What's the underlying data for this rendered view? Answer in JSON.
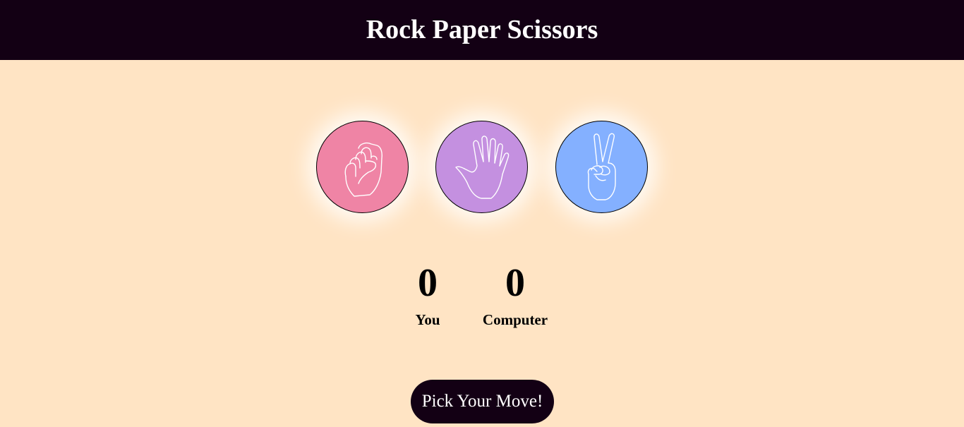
{
  "header": {
    "title": "Rock Paper Scissors"
  },
  "choices": [
    {
      "id": "rock",
      "icon": "rock-fist-icon",
      "color": "#ef84a5"
    },
    {
      "id": "paper",
      "icon": "paper-hand-icon",
      "color": "#c490e0"
    },
    {
      "id": "scissors",
      "icon": "scissors-hand-icon",
      "color": "#84b0ff"
    }
  ],
  "scoreboard": {
    "user": {
      "score": "0",
      "label": "You"
    },
    "computer": {
      "score": "0",
      "label": "Computer"
    }
  },
  "action": {
    "label": "Pick Your Move!"
  },
  "colors": {
    "header_bg": "#130014",
    "page_bg": "#ffe4c4",
    "button_bg": "#130014"
  }
}
